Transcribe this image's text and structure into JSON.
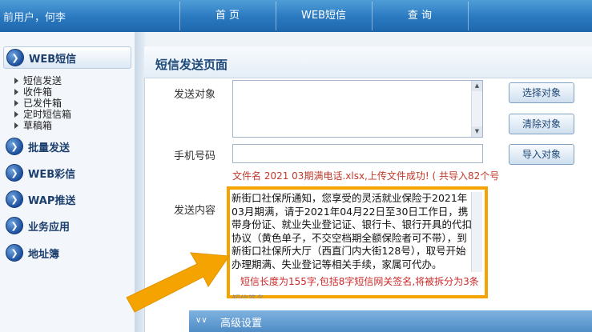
{
  "header": {
    "user_text": "前用户，何李",
    "nav": [
      "首 页",
      "WEB短信",
      "查 询"
    ]
  },
  "sidebar": {
    "groups": [
      {
        "label": "WEB短信",
        "icon": "arrow-circle-icon"
      },
      {
        "label": "批量发送",
        "icon": "arrow-circle-icon"
      },
      {
        "label": "WEB彩信",
        "icon": "arrow-circle-icon"
      },
      {
        "label": "WAP推送",
        "icon": "arrow-circle-icon"
      },
      {
        "label": "业务应用",
        "icon": "arrow-circle-icon"
      },
      {
        "label": "地址簿",
        "icon": "arrow-circle-icon"
      }
    ],
    "sub_items": [
      "短信发送",
      "收件箱",
      "已发件箱",
      "定时短信箱",
      "草稿箱"
    ]
  },
  "panel": {
    "title": "短信发送页面",
    "send_target_label": "发送对象",
    "phone_label": "手机号码",
    "content_label": "发送内容",
    "upload_status": "文件名 2021 03期满电话.xlsx,上传文件成功! ( 共导入82个号",
    "content_text": "新街口社保所通知，您享受的灵活就业保险于2021年03月期满，请于2021年04月22日至30日工作日，携带身份证、就业失业登记证、银行卡、银行开具的代扣协议（黄色单子，不交空档期全额保险者可不带），到新街口社保所大厅（西直门内大街128号），取号开始办理期满、失业登记等相关手续，家属可代办。",
    "length_info": "短信长度为155字,包括8字短信网关签名,将被拆分为3条",
    "partial_line": "短信签名",
    "advanced_label": "高级设置"
  },
  "buttons": {
    "select": "选择对象",
    "clear": "清除对象",
    "import": "导入对象"
  },
  "colors": {
    "highlight": "#f4a300",
    "status_red": "#c0392b",
    "header_blue": "#2a78bf"
  }
}
